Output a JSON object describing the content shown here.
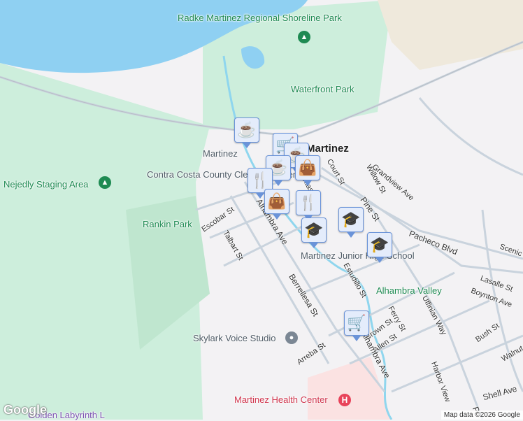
{
  "map": {
    "city_label": "Martinez",
    "parks": [
      {
        "name": "Radke Martinez Regional Shoreline Park"
      },
      {
        "name": "Waterfront Park"
      },
      {
        "name": "Nejedly Staging Area"
      },
      {
        "name": "Rankin Park"
      },
      {
        "name": "Alhambra Valley"
      }
    ],
    "pois": {
      "station": "Martinez",
      "county": "Contra Costa County Clerk-Recorder",
      "school": "Martinez Junior High School",
      "studio": "Skylark Voice Studio",
      "health": "Martinez Health Center",
      "labyrinth": "Golden Labyrinth L"
    },
    "streets": [
      "Escobar St",
      "Talbart St",
      "Alhambra Ave",
      "Berrellesa St",
      "Estudillo St",
      "Court St",
      "Juntas St",
      "Willow St",
      "Grandview Ave",
      "Pine St",
      "Pacheco Blvd",
      "Scenic",
      "Lasalle St",
      "Boynton Ave",
      "Uffinian Way",
      "Ferry St",
      "Brown St",
      "Allen St",
      "Bush St",
      "Walnut",
      "Arreba St",
      "Harbor View",
      "Shell Ave",
      "Alhambra Ave",
      "Pi"
    ],
    "markers": [
      "coffee-icon",
      "shopping-cart-icon",
      "coffee-icon",
      "shopping-bag-icon",
      "restaurant-icon",
      "shopping-bag-icon",
      "restaurant-icon",
      "graduation-cap-icon",
      "graduation-cap-icon",
      "graduation-cap-icon",
      "shopping-cart-icon"
    ],
    "attribution": "Map data ©2026 Google",
    "logo": "Google",
    "colors": {
      "water": "#8fd0f2",
      "park": "#cdeedc",
      "road": "#c9d3dd",
      "marker": "#0d3d63"
    }
  }
}
